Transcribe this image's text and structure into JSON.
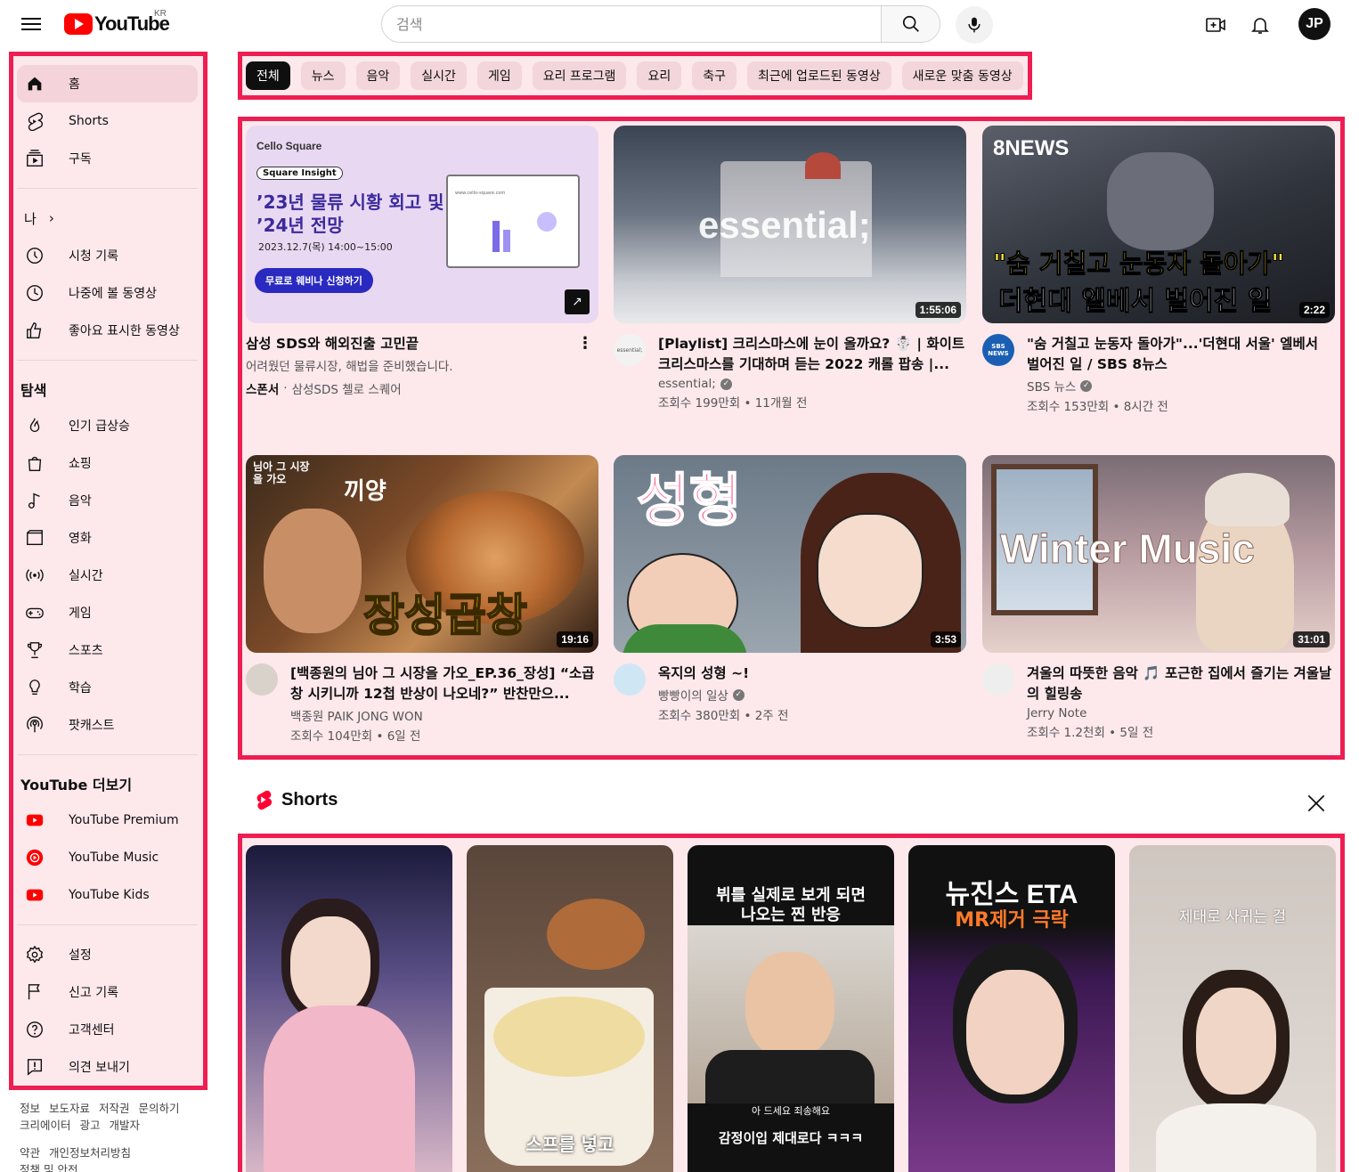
{
  "header": {
    "logo_text": "YouTube",
    "logo_region": "KR",
    "search_placeholder": "검색",
    "avatar_initials": "JP"
  },
  "sidebar": {
    "main": [
      {
        "label": "홈",
        "icon": "home-icon"
      },
      {
        "label": "Shorts",
        "icon": "shorts-icon"
      },
      {
        "label": "구독",
        "icon": "subscriptions-icon"
      }
    ],
    "you_header": "나",
    "you": [
      {
        "label": "시청 기록",
        "icon": "history-icon"
      },
      {
        "label": "나중에 볼 동영상",
        "icon": "watch-later-icon"
      },
      {
        "label": "좋아요 표시한 동영상",
        "icon": "thumbs-up-icon"
      }
    ],
    "explore_header": "탐색",
    "explore": [
      {
        "label": "인기 급상승",
        "icon": "trending-icon"
      },
      {
        "label": "쇼핑",
        "icon": "shopping-icon"
      },
      {
        "label": "음악",
        "icon": "music-icon"
      },
      {
        "label": "영화",
        "icon": "movie-icon"
      },
      {
        "label": "실시간",
        "icon": "live-icon"
      },
      {
        "label": "게임",
        "icon": "gaming-icon"
      },
      {
        "label": "스포츠",
        "icon": "sports-icon"
      },
      {
        "label": "학습",
        "icon": "learning-icon"
      },
      {
        "label": "팟캐스트",
        "icon": "podcast-icon"
      }
    ],
    "more_header": "YouTube 더보기",
    "more": [
      {
        "label": "YouTube Premium",
        "icon": "youtube-premium-icon"
      },
      {
        "label": "YouTube Music",
        "icon": "youtube-music-icon"
      },
      {
        "label": "YouTube Kids",
        "icon": "youtube-kids-icon"
      }
    ],
    "settings": [
      {
        "label": "설정",
        "icon": "settings-icon"
      },
      {
        "label": "신고 기록",
        "icon": "flag-icon"
      },
      {
        "label": "고객센터",
        "icon": "help-icon"
      },
      {
        "label": "의견 보내기",
        "icon": "feedback-icon"
      }
    ],
    "footer": {
      "row1": [
        "정보",
        "보도자료",
        "저작권",
        "문의하기"
      ],
      "row2": [
        "크리에이터",
        "광고",
        "개발자"
      ],
      "row3": [
        "약관",
        "개인정보처리방침"
      ],
      "row4": [
        "정책 및 안전"
      ]
    }
  },
  "chips": [
    "전체",
    "뉴스",
    "음악",
    "실시간",
    "게임",
    "요리 프로그램",
    "요리",
    "축구",
    "최근에 업로드된 동영상",
    "새로운 맞춤 동영상"
  ],
  "videos": [
    {
      "title": "삼성 SDS와 해외진출 고민끝",
      "desc": "어려웠던 물류시장, 해법을 준비했습니다.",
      "sponsor_label": "스폰서",
      "channel": "삼성SDS 첼로 스퀘어",
      "thumb": {
        "brand": "Cello Square",
        "badge": "Square Insight",
        "line1": "’23년 물류 시황 회고 및",
        "line2": "’24년 전망",
        "date": "2023.12.7(목) 14:00~15:00",
        "cta": "무료로 웨비나 신청하기",
        "url": "www.cello-square.com"
      }
    },
    {
      "title": "[Playlist] 크리스마스에 눈이 올까요? ☃️ | 화이트 크리스마스를 기대하며 듣는 2022 캐롤 팝송 |...",
      "channel": "essential;",
      "stats": "조회수 199만회 • 11개월 전",
      "duration": "1:55:06",
      "thumb_text": "essential;",
      "avatar_text": "essential;"
    },
    {
      "title": "\"숨 거칠고 눈동자 돌아가\"...'더현대 서울' 엘베서 벌어진 일 / SBS 8뉴스",
      "channel": "SBS 뉴스",
      "stats": "조회수 153만회 • 8시간 전",
      "duration": "2:22",
      "thumb_brand": "8NEWS",
      "thumb_line1": "\"숨 거칠고 눈동자 돌아가\"",
      "thumb_line2": "더현대 엘베서 벌어진 일",
      "avatar_text": "SBS NEWS"
    },
    {
      "title": "[백종원의 님아 그 시장을 가오_EP.36_장성] “소곱창 시키니까 12첩 반상이 나오네?” 반찬만으...",
      "channel": "백종원 PAIK JONG WON",
      "stats": "조회수 104만회 • 6일 전",
      "duration": "19:16",
      "thumb_text": "장성곱창",
      "thumb_corner": "님아 그 시장을 가오",
      "thumb_sound": "끼양"
    },
    {
      "title": "옥지의 성형 ~!",
      "channel": "빵빵이의 일상",
      "stats": "조회수 380만회 • 2주 전",
      "duration": "3:53",
      "thumb_text": "성형"
    },
    {
      "title": "겨울의 따뜻한 음악 🎵 포근한 집에서 즐기는 겨울날의 힐링송",
      "channel": "Jerry Note",
      "stats": "조회수 1.2천회 • 5일 전",
      "duration": "31:01",
      "thumb_text": "Winter Music"
    }
  ],
  "shorts": {
    "title": "Shorts",
    "items": [
      {
        "caption": ""
      },
      {
        "caption": "스프를 넣고"
      },
      {
        "caption_top": "뷔를 실제로 보게 되면\n나오는 찐 반응",
        "caption_bottom": "감정이입 제대로다 ㅋㅋㅋ",
        "caption_small": "아 드세요 죄송해요"
      },
      {
        "caption_top": "뉴진스 ETA",
        "caption_sub": "MR제거 극락"
      },
      {
        "caption_top": "제대로 사귀는 걸"
      }
    ]
  },
  "colors": {
    "highlight_border": "#ee1d52",
    "highlight_fill": "#fde8ec",
    "brand_red": "#ff0000"
  }
}
